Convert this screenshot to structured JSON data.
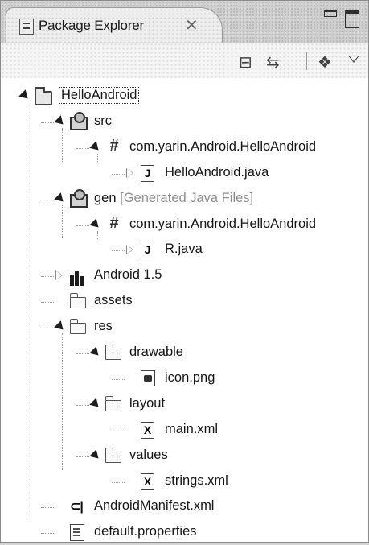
{
  "view": {
    "title": "Package Explorer",
    "icons": {
      "tab": "package-explorer-icon",
      "close": "close-icon",
      "minimize": "minimize-icon",
      "maximize": "maximize-icon"
    }
  },
  "toolbar": {
    "items": [
      {
        "name": "collapse-all-icon",
        "glyph": "⊟"
      },
      {
        "name": "link-with-editor-icon",
        "glyph": "⇆"
      },
      {
        "name": "filter-icon",
        "glyph": "❖"
      },
      {
        "name": "view-menu-icon",
        "glyph": "▽"
      }
    ]
  },
  "tree": [
    {
      "id": "helloandroid",
      "depth": 0,
      "state": "expanded",
      "icon": "project-icon",
      "label": "HelloAndroid",
      "decoration": "",
      "selected": true
    },
    {
      "id": "src",
      "depth": 1,
      "state": "expanded",
      "icon": "source-folder-icon",
      "label": "src",
      "decoration": ""
    },
    {
      "id": "src-package",
      "depth": 2,
      "state": "expanded",
      "icon": "package-icon",
      "label": "com.yarin.Android.HelloAndroid",
      "decoration": ""
    },
    {
      "id": "helloandroid-java",
      "depth": 3,
      "state": "collapsed",
      "icon": "java-file-icon",
      "label": "HelloAndroid.java",
      "decoration": ""
    },
    {
      "id": "gen",
      "depth": 1,
      "state": "expanded",
      "icon": "source-folder-icon",
      "label": "gen",
      "decoration": "[Generated Java Files]"
    },
    {
      "id": "gen-package",
      "depth": 2,
      "state": "expanded",
      "icon": "package-icon",
      "label": "com.yarin.Android.HelloAndroid",
      "decoration": ""
    },
    {
      "id": "r-java",
      "depth": 3,
      "state": "collapsed",
      "icon": "java-file-icon",
      "label": "R.java",
      "decoration": ""
    },
    {
      "id": "android-lib",
      "depth": 1,
      "state": "collapsed",
      "icon": "library-icon",
      "label": "Android 1.5",
      "decoration": ""
    },
    {
      "id": "assets",
      "depth": 1,
      "state": "none",
      "icon": "folder-icon",
      "label": "assets",
      "decoration": ""
    },
    {
      "id": "res",
      "depth": 1,
      "state": "expanded",
      "icon": "folder-icon",
      "label": "res",
      "decoration": ""
    },
    {
      "id": "drawable",
      "depth": 2,
      "state": "expanded",
      "icon": "folder-icon",
      "label": "drawable",
      "decoration": ""
    },
    {
      "id": "icon-png",
      "depth": 3,
      "state": "none",
      "icon": "image-file-icon",
      "label": "icon.png",
      "decoration": ""
    },
    {
      "id": "layout",
      "depth": 2,
      "state": "expanded",
      "icon": "folder-icon",
      "label": "layout",
      "decoration": ""
    },
    {
      "id": "main-xml",
      "depth": 3,
      "state": "none",
      "icon": "xml-file-icon",
      "label": "main.xml",
      "decoration": ""
    },
    {
      "id": "values",
      "depth": 2,
      "state": "expanded",
      "icon": "folder-icon",
      "label": "values",
      "decoration": ""
    },
    {
      "id": "strings-xml",
      "depth": 3,
      "state": "none",
      "icon": "xml-file-icon",
      "label": "strings.xml",
      "decoration": ""
    },
    {
      "id": "manifest",
      "depth": 1,
      "state": "none",
      "icon": "manifest-file-icon",
      "label": "AndroidManifest.xml",
      "decoration": ""
    },
    {
      "id": "default-properties",
      "depth": 1,
      "state": "none",
      "icon": "properties-file-icon",
      "label": "default.properties",
      "decoration": ""
    }
  ]
}
